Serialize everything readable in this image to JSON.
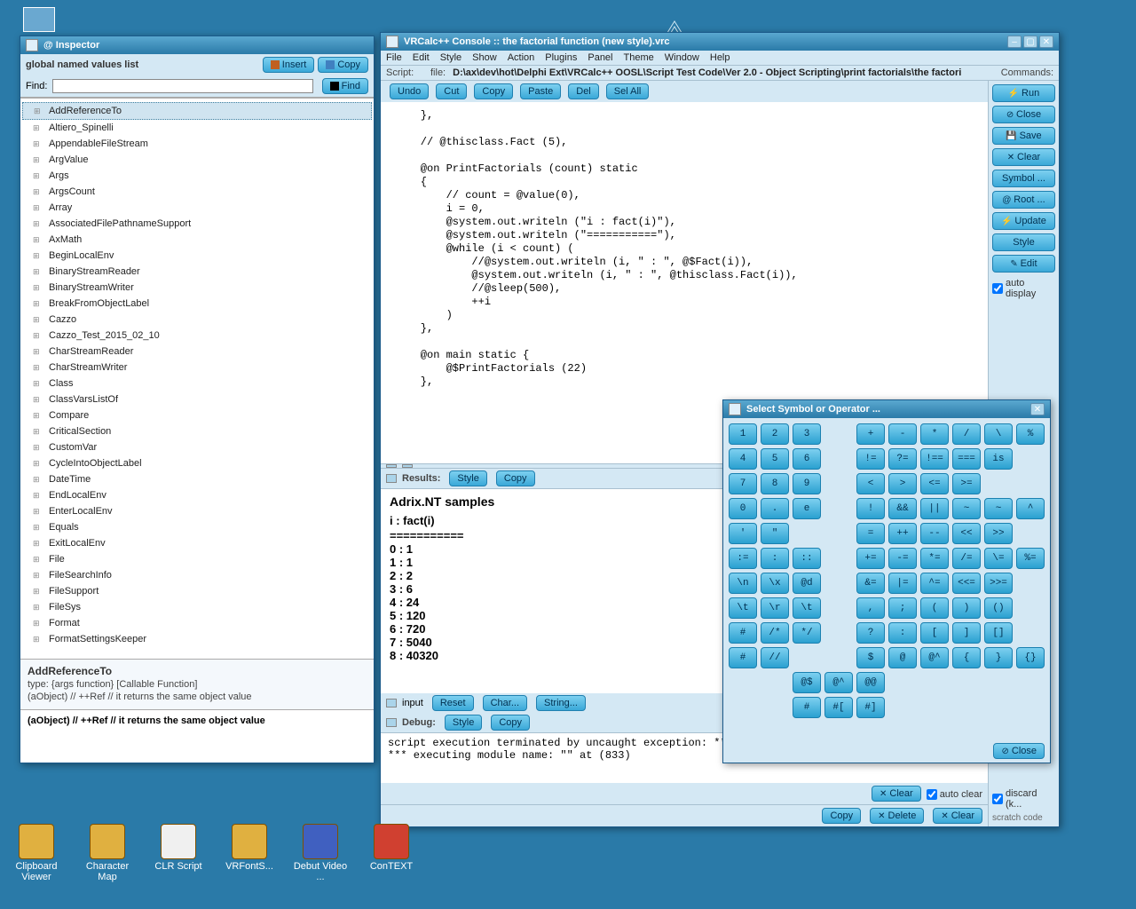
{
  "inspector": {
    "title": "@ Inspector",
    "list_label": "global named values list",
    "insert": "Insert",
    "copy": "Copy",
    "find_label": "Find:",
    "find_btn": "Find",
    "items": [
      "AddReferenceTo",
      "Altiero_Spinelli",
      "AppendableFileStream",
      "ArgValue",
      "Args",
      "ArgsCount",
      "Array",
      "AssociatedFilePathnameSupport",
      "AxMath",
      "BeginLocalEnv",
      "BinaryStreamReader",
      "BinaryStreamWriter",
      "BreakFromObjectLabel",
      "Cazzo",
      "Cazzo_Test_2015_02_10",
      "CharStreamReader",
      "CharStreamWriter",
      "Class",
      "ClassVarsListOf",
      "Compare",
      "CriticalSection",
      "CustomVar",
      "CycleIntoObjectLabel",
      "DateTime",
      "EndLocalEnv",
      "EnterLocalEnv",
      "Equals",
      "ExitLocalEnv",
      "File",
      "FileSearchInfo",
      "FileSupport",
      "FileSys",
      "Format",
      "FormatSettingsKeeper"
    ],
    "selected_index": 0,
    "detail_title": "AddReferenceTo",
    "detail_type": "type: {args function} [Callable Function]",
    "detail_short": "(aObject) // ++Ref // it returns the same object value",
    "detail_full": "(aObject) // ++Ref // it returns the same object value"
  },
  "console": {
    "title": "VRCalc++ Console :: the factorial function (new style).vrc",
    "menus": [
      "File",
      "Edit",
      "Style",
      "Show",
      "Action",
      "Plugins",
      "Panel",
      "Theme",
      "Window",
      "Help"
    ],
    "script_label": "Script:",
    "file_label": "file:",
    "file_path": "D:\\ax\\dev\\hot\\Delphi Ext\\VRCalc++ OOSL\\Script Test Code\\Ver 2.0 - Object Scripting\\print factorials\\the factori",
    "commands_label": "Commands:",
    "toolbar": {
      "undo": "Undo",
      "cut": "Cut",
      "copy": "Copy",
      "paste": "Paste",
      "del": "Del",
      "selall": "Sel All"
    },
    "sidebar": {
      "run": "Run",
      "close": "Close",
      "save": "Save",
      "clear": "Clear",
      "symbol": "Symbol ...",
      "root": "Root ...",
      "update": "Update",
      "style": "Style",
      "edit": "Edit",
      "auto_display": "auto display",
      "discard": "discard (k...",
      "scratch": "scratch code"
    },
    "code_lines": [
      "    },",
      "",
      "    // @thisclass.Fact (5),",
      "",
      "    @on PrintFactorials (count) static",
      "    {",
      "        // count = @value(0),",
      "        i = 0,",
      "        @system.out.writeln (\"i : fact(i)\"),",
      "        @system.out.writeln (\"===========\"),",
      "        @while (i < count) (",
      "            //@system.out.writeln (i, \" : \", @$Fact(i)),",
      "            @system.out.writeln (i, \" : \", @thisclass.Fact(i)),",
      "            //@sleep(500),",
      "            ++i",
      "        )",
      "    },",
      "",
      "    @on main static {",
      "        @$PrintFactorials (22)",
      "    },"
    ],
    "results": {
      "label": "Results:",
      "style": "Style",
      "copy": "Copy",
      "heading": "Adrix.NT samples",
      "line1": "i : fact(i)",
      "line2": "===========",
      "rows": [
        "0 : 1",
        "1 : 1",
        "2 : 2",
        "3 : 6",
        "4 : 24",
        "5 : 120",
        "6 : 720",
        "7 : 5040",
        "8 : 40320"
      ]
    },
    "input": {
      "label": "input",
      "reset": "Reset",
      "char": "Char...",
      "string": "String...",
      "clear": "Clear"
    },
    "debug": {
      "label": "Debug:",
      "style": "Style",
      "copy": "Copy",
      "lines": [
        "script execution terminated by uncaught exception:",
        "*** [Invalid floating point operation] ***",
        "executing module name: \"\" at (833)"
      ]
    },
    "bottom": {
      "clear": "Clear",
      "auto_clear": "auto clear",
      "copy": "Copy",
      "delete": "Delete",
      "clear2": "Clear"
    }
  },
  "symbols": {
    "title": "Select Symbol or Operator ...",
    "close": "Close",
    "cells": [
      "1",
      "2",
      "3",
      "",
      "+",
      "-",
      "*",
      "/",
      "\\",
      "%",
      "4",
      "5",
      "6",
      "",
      "!=",
      "?=",
      "!==",
      "===",
      "is",
      "",
      "7",
      "8",
      "9",
      "",
      "<",
      ">",
      "<=",
      ">=",
      "",
      "",
      "0",
      ".",
      "e",
      "",
      "!",
      "&&",
      "||",
      "~",
      "~",
      "^",
      "'",
      "\"",
      "",
      "",
      "=",
      "++",
      "--",
      "<<",
      ">>",
      "",
      ":=",
      ":",
      "::",
      "",
      "+=",
      "-=",
      "*=",
      "/=",
      "\\=",
      "%=",
      "\\n",
      "\\x",
      "@d",
      "",
      "&=",
      "|=",
      "^=",
      "<<=",
      ">>=",
      "",
      "\\t",
      "\\r",
      "\\t",
      "",
      ",",
      ";",
      "(",
      ")",
      "()",
      "",
      "#",
      "/*",
      "*/",
      "",
      "?",
      ":",
      "[",
      "]",
      "[]",
      "",
      "#",
      "//",
      "",
      "",
      "$",
      "@",
      "@^",
      "{",
      "}",
      "{}",
      "",
      "",
      "@$",
      "@^",
      "@@",
      "",
      "",
      "",
      "",
      "",
      "",
      "",
      "#",
      "#[",
      "#]",
      "",
      "",
      ""
    ]
  },
  "desktop": {
    "icons": [
      "Clipboard Viewer",
      "Character Map",
      "CLR Script",
      "VRFontS...",
      "Debut Video ...",
      "ConTEXT"
    ]
  }
}
